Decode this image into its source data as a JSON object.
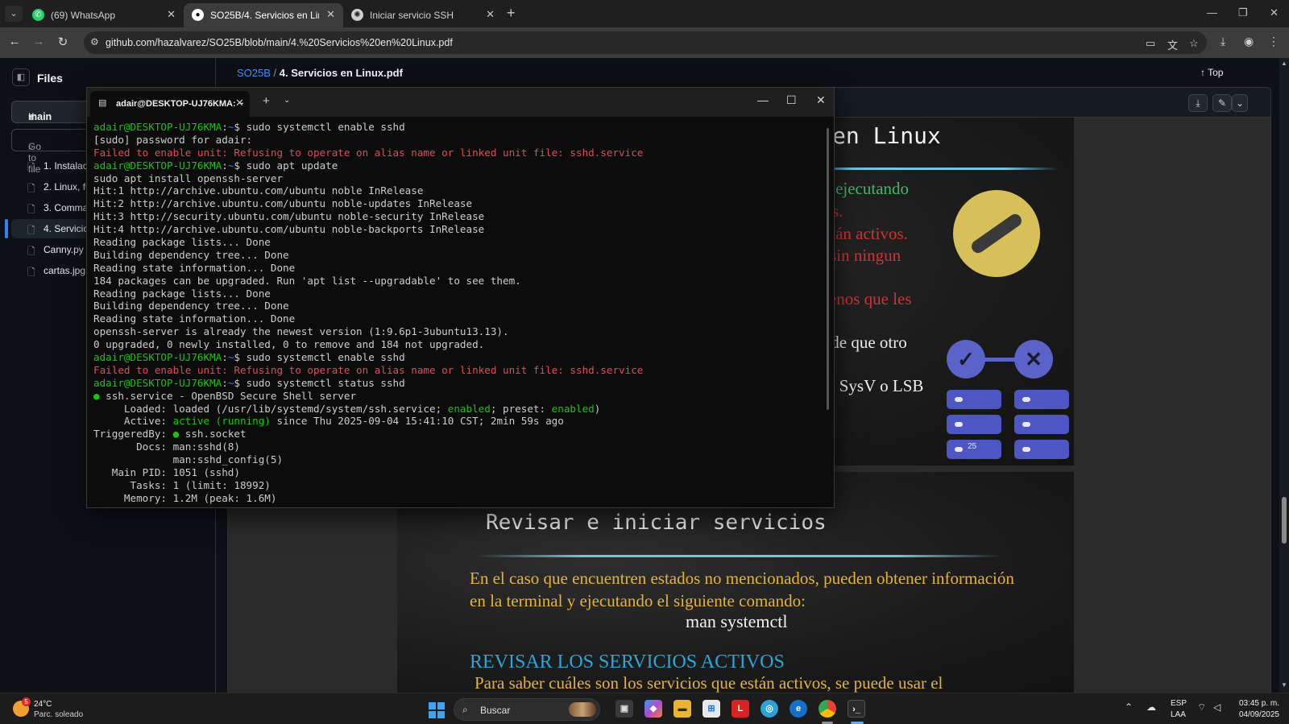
{
  "browser": {
    "tabs": [
      {
        "label": "(69) WhatsApp",
        "icon": "whatsapp-icon"
      },
      {
        "label": "SO25B/4. Servicios en Linux.pdf",
        "icon": "github-icon"
      },
      {
        "label": "Iniciar servicio SSH",
        "icon": "chatgpt-icon"
      }
    ],
    "url": "github.com/hazalvarez/SO25B/blob/main/4.%20Servicios%20en%20Linux.pdf"
  },
  "github": {
    "sidebar": {
      "title": "Files",
      "branch": "main",
      "goto_placeholder": "Go to file",
      "files": [
        {
          "name": "1. Instalaci"
        },
        {
          "name": "2. Linux, fu"
        },
        {
          "name": "3. Commar"
        },
        {
          "name": "4. Servicios"
        },
        {
          "name": "Canny.py"
        },
        {
          "name": "cartas.jpg"
        }
      ]
    },
    "breadcrumb": {
      "repo": "SO25B",
      "separator": "/",
      "file": "4. Servicios en Linux.pdf"
    },
    "top_label": "Top",
    "slide1": {
      "title": "en Linux",
      "lines": [
        {
          "text": "stán ejecutando",
          "color": "#3fb867"
        },
        {
          "text": "emas.",
          "color": "#cf3434"
        },
        {
          "text": "o están activos.",
          "color": "#cf3434"
        },
        {
          "text": "nto sin ningun",
          "color": "#cf3434"
        },
        {
          "text": "a menos que les",
          "color": "#cf3434"
        },
        {
          "text": "aso de que otro",
          "color": "#eeeeee"
        },
        {
          "text": "cript SysV o LSB",
          "color": "#eeeeee"
        }
      ],
      "pill_number": "25"
    },
    "slide2": {
      "title": "Revisar e iniciar servicios",
      "body": "En el caso que encuentren estados no mencionados, pueden obtener información en la terminal y ejecutando el siguiente comando:",
      "command": "man systemctl",
      "heading": "REVISAR LOS SERVICIOS ACTIVOS",
      "cut_text": "Para saber cuáles son los servicios que están activos, se puede usar el"
    }
  },
  "terminal": {
    "tab_title": "adair@DESKTOP-UJ76KMA: ~",
    "colors": {
      "prompt": "#16c60c",
      "error": "#e74856",
      "normal": "#cccccc",
      "path": "#3b78ff"
    },
    "lines": [
      [
        {
          "t": "adair@DESKTOP-UJ76KMA",
          "c": "#16c60c"
        },
        {
          "t": ":",
          "c": "#cccccc"
        },
        {
          "t": "~",
          "c": "#3b78ff"
        },
        {
          "t": "$ sudo systemctl enable sshd",
          "c": "#cccccc"
        }
      ],
      [
        {
          "t": "[sudo] password for adair:",
          "c": "#cccccc"
        }
      ],
      [
        {
          "t": "Failed to enable unit: Refusing to operate on alias name or linked unit file: sshd.service",
          "c": "#e74856"
        }
      ],
      [
        {
          "t": "adair@DESKTOP-UJ76KMA",
          "c": "#16c60c"
        },
        {
          "t": ":",
          "c": "#cccccc"
        },
        {
          "t": "~",
          "c": "#3b78ff"
        },
        {
          "t": "$ sudo apt update",
          "c": "#cccccc"
        }
      ],
      [
        {
          "t": "sudo apt install openssh-server",
          "c": "#cccccc"
        }
      ],
      [
        {
          "t": "Hit:1 http://archive.ubuntu.com/ubuntu noble InRelease",
          "c": "#cccccc"
        }
      ],
      [
        {
          "t": "Hit:2 http://archive.ubuntu.com/ubuntu noble-updates InRelease",
          "c": "#cccccc"
        }
      ],
      [
        {
          "t": "Hit:3 http://security.ubuntu.com/ubuntu noble-security InRelease",
          "c": "#cccccc"
        }
      ],
      [
        {
          "t": "Hit:4 http://archive.ubuntu.com/ubuntu noble-backports InRelease",
          "c": "#cccccc"
        }
      ],
      [
        {
          "t": "Reading package lists... Done",
          "c": "#cccccc"
        }
      ],
      [
        {
          "t": "Building dependency tree... Done",
          "c": "#cccccc"
        }
      ],
      [
        {
          "t": "Reading state information... Done",
          "c": "#cccccc"
        }
      ],
      [
        {
          "t": "184 packages can be upgraded. Run 'apt list --upgradable' to see them.",
          "c": "#cccccc"
        }
      ],
      [
        {
          "t": "Reading package lists... Done",
          "c": "#cccccc"
        }
      ],
      [
        {
          "t": "Building dependency tree... Done",
          "c": "#cccccc"
        }
      ],
      [
        {
          "t": "Reading state information... Done",
          "c": "#cccccc"
        }
      ],
      [
        {
          "t": "openssh-server is already the newest version (1:9.6p1-3ubuntu13.13).",
          "c": "#cccccc"
        }
      ],
      [
        {
          "t": "0 upgraded, 0 newly installed, 0 to remove and 184 not upgraded.",
          "c": "#cccccc"
        }
      ],
      [
        {
          "t": "adair@DESKTOP-UJ76KMA",
          "c": "#16c60c"
        },
        {
          "t": ":",
          "c": "#cccccc"
        },
        {
          "t": "~",
          "c": "#3b78ff"
        },
        {
          "t": "$ sudo systemctl enable sshd",
          "c": "#cccccc"
        }
      ],
      [
        {
          "t": "Failed to enable unit: Refusing to operate on alias name or linked unit file: sshd.service",
          "c": "#e74856"
        }
      ],
      [
        {
          "t": "adair@DESKTOP-UJ76KMA",
          "c": "#16c60c"
        },
        {
          "t": ":",
          "c": "#cccccc"
        },
        {
          "t": "~",
          "c": "#3b78ff"
        },
        {
          "t": "$ sudo systemctl status sshd",
          "c": "#cccccc"
        }
      ],
      [
        {
          "t": "●",
          "c": "#16c60c"
        },
        {
          "t": " ssh.service - OpenBSD Secure Shell server",
          "c": "#cccccc"
        }
      ],
      [
        {
          "t": "     Loaded: loaded (/usr/lib/systemd/system/ssh.service; ",
          "c": "#cccccc"
        },
        {
          "t": "enabled",
          "c": "#16c60c"
        },
        {
          "t": "; preset: ",
          "c": "#cccccc"
        },
        {
          "t": "enabled",
          "c": "#16c60c"
        },
        {
          "t": ")",
          "c": "#cccccc"
        }
      ],
      [
        {
          "t": "     Active: ",
          "c": "#cccccc"
        },
        {
          "t": "active (running)",
          "c": "#16c60c"
        },
        {
          "t": " since Thu 2025-09-04 15:41:10 CST; 2min 59s ago",
          "c": "#cccccc"
        }
      ],
      [
        {
          "t": "TriggeredBy: ",
          "c": "#cccccc"
        },
        {
          "t": "●",
          "c": "#16c60c"
        },
        {
          "t": " ssh.socket",
          "c": "#cccccc"
        }
      ],
      [
        {
          "t": "       Docs: man:sshd(8)",
          "c": "#cccccc"
        }
      ],
      [
        {
          "t": "             man:sshd_config(5)",
          "c": "#cccccc"
        }
      ],
      [
        {
          "t": "   Main PID: 1051 (sshd)",
          "c": "#cccccc"
        }
      ],
      [
        {
          "t": "      Tasks: 1 (limit: 18992)",
          "c": "#cccccc"
        }
      ],
      [
        {
          "t": "     Memory: 1.2M (peak: 1.6M)",
          "c": "#cccccc"
        }
      ]
    ]
  },
  "taskbar": {
    "weather_badge": "5",
    "temperature": "24°C",
    "weather": "Parc. soleado",
    "search_label": "Buscar",
    "lang1": "ESP",
    "lang2": "LAA",
    "time": "03:45 p. m.",
    "date": "04/09/2025"
  }
}
